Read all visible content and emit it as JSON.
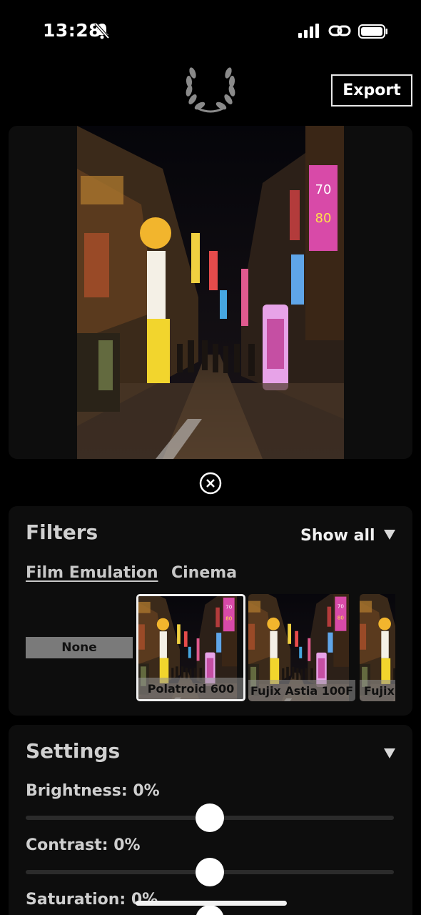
{
  "status": {
    "time": "13:28",
    "icons": [
      "bell-slash-icon",
      "signal-icon",
      "link-icon",
      "battery-icon"
    ]
  },
  "header": {
    "logo_icon": "laurel-wreath-icon",
    "export_label": "Export"
  },
  "preview": {
    "image_desc": "night-street-neon-signs"
  },
  "filters": {
    "title": "Filters",
    "show_all_label": "Show all",
    "categories": [
      "Film Emulation",
      "Cinema"
    ],
    "active_category": "Film Emulation",
    "items": [
      {
        "label": "None"
      },
      {
        "label": "Polatroid 600",
        "selected": true
      },
      {
        "label": "Fujix Astia 100F"
      },
      {
        "label": "Fujix"
      }
    ]
  },
  "settings": {
    "title": "Settings",
    "sliders": [
      {
        "label": "Brightness: 0%",
        "value": 0.5
      },
      {
        "label": "Contrast: 0%",
        "value": 0.5
      },
      {
        "label": "Saturation: 0%",
        "value": 0.5
      }
    ]
  },
  "colors": {
    "background": "#000000",
    "card": "#0d0d0d",
    "accent": "#ffffff"
  }
}
